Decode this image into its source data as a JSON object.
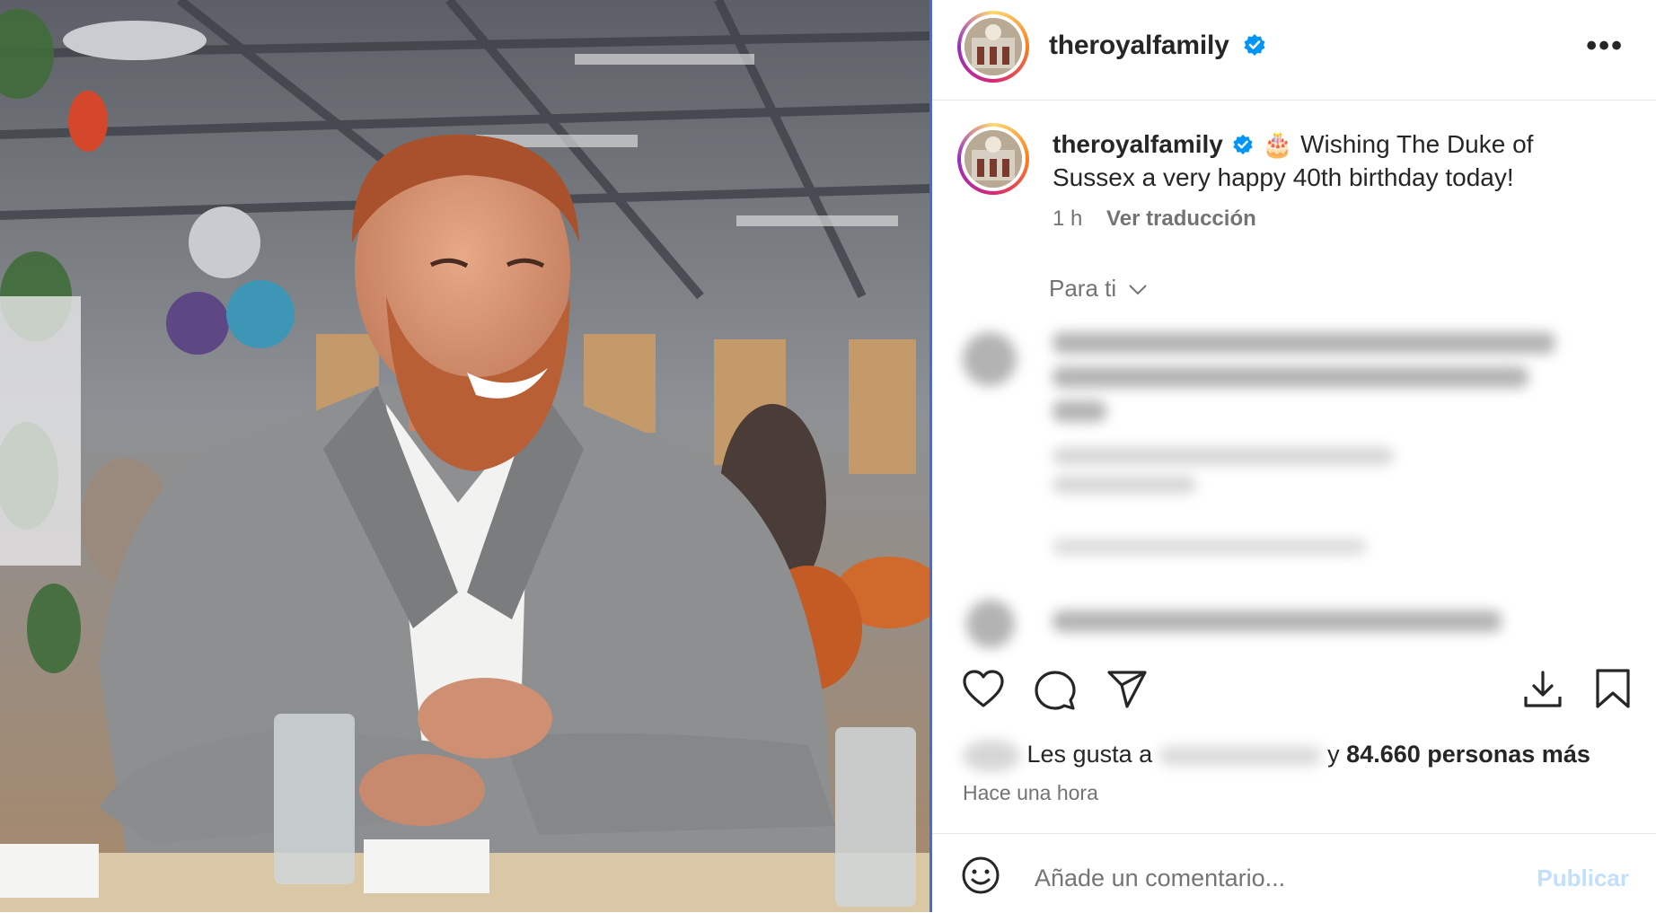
{
  "post": {
    "username": "theroyalfamily",
    "verified": true,
    "more_label": "•••"
  },
  "caption": {
    "username": "theroyalfamily",
    "emoji": "🎂",
    "text": "Wishing The Duke of Sussex a very happy 40th birthday today!",
    "time": "1 h",
    "translate": "Ver traducción"
  },
  "comments_section": {
    "filter_label": "Para ti"
  },
  "likes": {
    "prefix": "Les gusta a",
    "connector": "y",
    "count_text": "84.660 personas más",
    "timestamp": "Hace una hora"
  },
  "comment_box": {
    "placeholder": "Añade un comentario...",
    "publish_label": "Publicar"
  },
  "colors": {
    "accent": "#0095f6",
    "verified": "#0095f6",
    "publish_disabled": "#c2dffd",
    "text_secondary": "#737373"
  },
  "icons": {
    "actions": [
      "heart-icon",
      "comment-icon",
      "share-icon",
      "download-icon",
      "bookmark-icon"
    ],
    "comment_box": "emoji-icon",
    "header": "more-options-icon"
  }
}
